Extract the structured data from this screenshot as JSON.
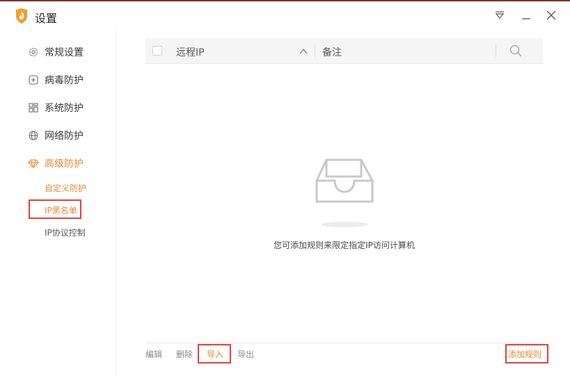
{
  "window": {
    "title": "设置",
    "controls": {
      "menu": "menu-icon",
      "minimize": "minimize-icon",
      "close": "close-icon"
    }
  },
  "sidebar": {
    "items": [
      {
        "label": "常规设置",
        "icon": "gear-icon"
      },
      {
        "label": "病毒防护",
        "icon": "plus-square-icon"
      },
      {
        "label": "系统防护",
        "icon": "grid-icon"
      },
      {
        "label": "网络防护",
        "icon": "globe-icon"
      },
      {
        "label": "高级防护",
        "icon": "diamond-icon"
      }
    ],
    "sub_items": [
      {
        "label": "自定义防护"
      },
      {
        "label": "IP黑名单"
      },
      {
        "label": "IP协议控制"
      }
    ]
  },
  "table": {
    "columns": [
      {
        "label": "远程IP"
      },
      {
        "label": "备注"
      }
    ]
  },
  "empty_state": {
    "message": "您可添加规则来限定指定IP访问计算机"
  },
  "toolbar": {
    "edit_label": "编辑",
    "delete_label": "删除",
    "import_label": "导入",
    "export_label": "导出",
    "add_rule_label": "添加规则"
  },
  "colors": {
    "accent": "#e8862e",
    "highlight": "#e53935",
    "title_bar_border": "#7a2b2b"
  }
}
